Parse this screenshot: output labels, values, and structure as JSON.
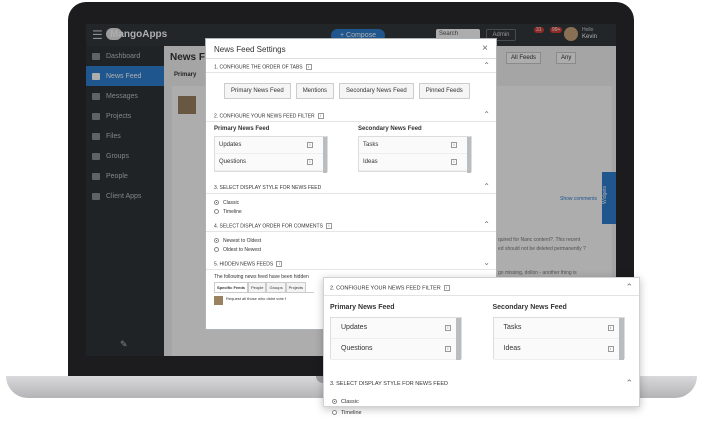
{
  "app": {
    "logo": "MangoApps",
    "compose": "+ Compose",
    "search": "Search",
    "admin": "Admin",
    "user_hello": "Hello",
    "user_name": "Kevin",
    "badge1": "31",
    "badge2": "99+"
  },
  "sidebar": {
    "items": [
      {
        "label": "Dashboard"
      },
      {
        "label": "News Feed"
      },
      {
        "label": "Messages"
      },
      {
        "label": "Projects"
      },
      {
        "label": "Files"
      },
      {
        "label": "Groups"
      },
      {
        "label": "People"
      },
      {
        "label": "Client Apps"
      }
    ]
  },
  "content": {
    "title": "News Fe",
    "primary_tab": "Primary",
    "all_feeds": "All Feeds",
    "any": "Any",
    "widgets": "Widgets",
    "show_comments": "Show comments",
    "bg_line1": "quired for Nanc content?. This recent",
    "bg_line2": "ed should not be deleted permanently ?",
    "bg_line3": "go missing, dollon - another thing is"
  },
  "modal": {
    "title": "News Feed Settings",
    "close": "×",
    "sections": {
      "order": "1. CONFIGURE THE ORDER OF TABS",
      "filter": "2. CONFIGURE YOUR NEWS FEED FILTER",
      "display": "3. SELECT DISPLAY STYLE FOR NEWS FEED",
      "comments": "4. SELECT DISPLAY ORDER FOR COMMENTS",
      "hidden": "5. HIDDEN NEWS FEEDS"
    },
    "tab_order": [
      "Primary News Feed",
      "Mentions",
      "Secondary News Feed",
      "Pinned Feeds"
    ],
    "primary_title": "Primary News Feed",
    "secondary_title": "Secondary News Feed",
    "primary_items": [
      "Updates",
      "Questions"
    ],
    "secondary_items": [
      "Tasks",
      "Ideas"
    ],
    "display_options": [
      "Classic",
      "Timeline"
    ],
    "comment_options": [
      "Newest to Oldest",
      "Oldest to Newest"
    ],
    "hidden_text": "The following news feed have been hidden",
    "hidden_tabs": [
      "Specific Feeds",
      "People",
      "Groups",
      "Projects"
    ],
    "hidden_item": "Request all those who didnt vote f"
  },
  "zoom": {
    "filter_head": "2. CONFIGURE YOUR NEWS FEED FILTER",
    "primary_title": "Primary News Feed",
    "secondary_title": "Secondary News Feed",
    "primary_items": [
      "Updates",
      "Questions"
    ],
    "secondary_items": [
      "Tasks",
      "Ideas"
    ],
    "display_head": "3. SELECT DISPLAY STYLE FOR NEWS FEED",
    "display_options": [
      "Classic",
      "Timeline"
    ]
  }
}
